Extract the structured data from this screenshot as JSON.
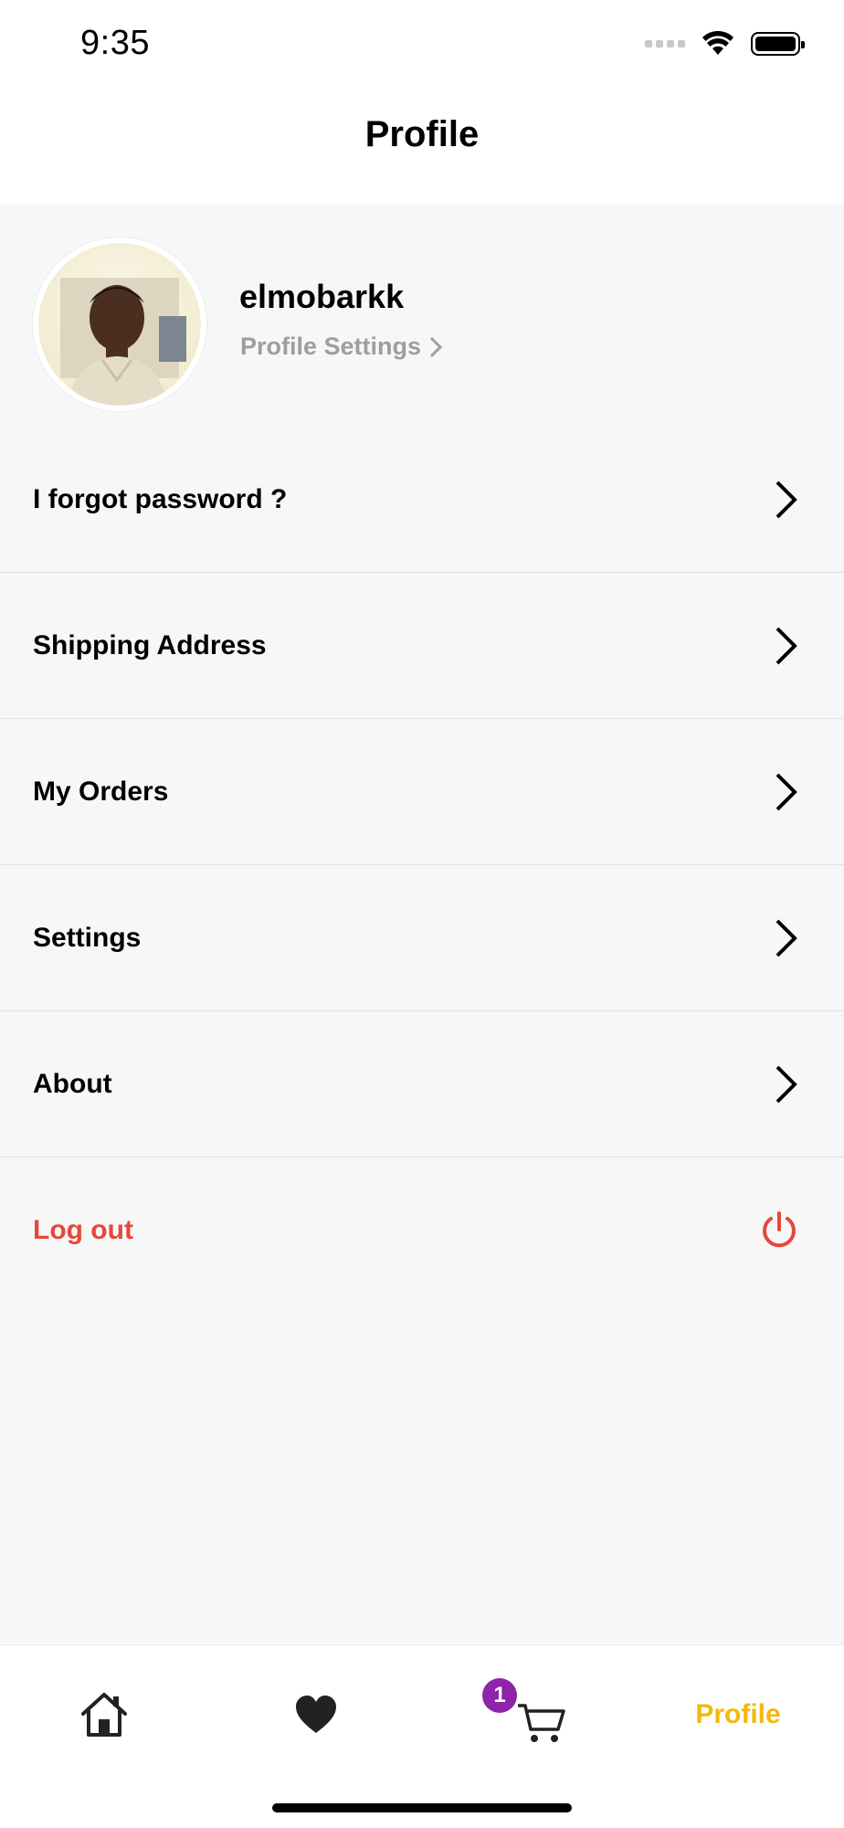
{
  "status_bar": {
    "time": "9:35"
  },
  "header": {
    "title": "Profile"
  },
  "profile": {
    "username": "elmobarkk",
    "settings_link": "Profile Settings"
  },
  "menu": {
    "items": [
      {
        "label": "I forgot password ?",
        "icon": "chevron-right-icon"
      },
      {
        "label": "Shipping Address",
        "icon": "chevron-right-icon"
      },
      {
        "label": "My Orders",
        "icon": "chevron-right-icon"
      },
      {
        "label": "Settings",
        "icon": "chevron-right-icon"
      },
      {
        "label": "About",
        "icon": "chevron-right-icon"
      }
    ],
    "logout": {
      "label": "Log out",
      "icon": "power-icon"
    }
  },
  "tabbar": {
    "home_icon": "home-icon",
    "favorites_icon": "heart-icon",
    "cart_icon": "cart-icon",
    "cart_badge": "1",
    "profile_label": "Profile"
  },
  "colors": {
    "accent": "#f2b90c",
    "logout": "#e5483b",
    "badge": "#8e24aa",
    "muted": "#9e9e9e"
  }
}
